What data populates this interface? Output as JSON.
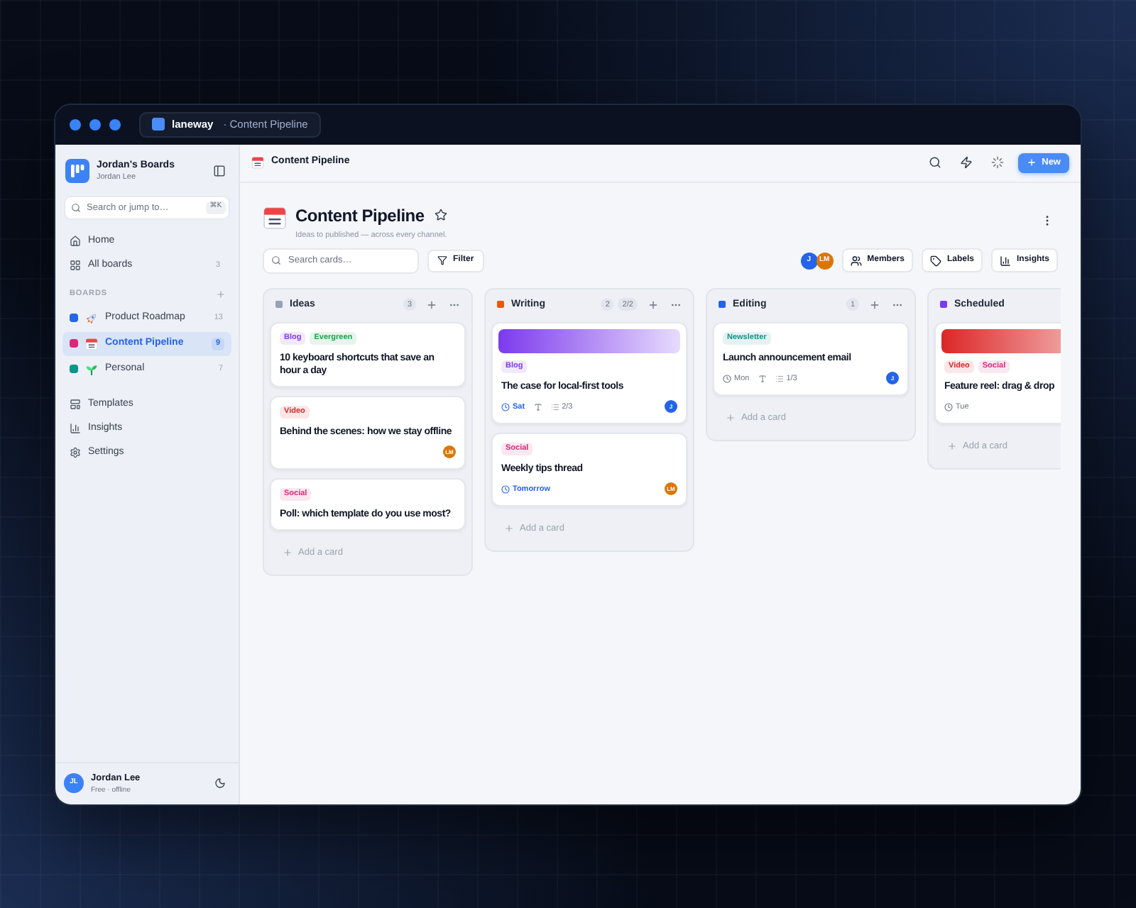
{
  "window": {
    "app_name": "laneway",
    "tab_title": "· Content Pipeline"
  },
  "sidebar": {
    "workspace": {
      "title": "Jordan's Boards",
      "subtitle": "Jordan Lee"
    },
    "search": {
      "placeholder": "Search or jump to…",
      "shortcut": "⌘K"
    },
    "nav": [
      {
        "label": "Home"
      },
      {
        "label": "All boards",
        "count": "3"
      }
    ],
    "boards_heading": "BOARDS",
    "boards": [
      {
        "label": "Product Roadmap",
        "count": "13",
        "color": "#2563eb",
        "selected": false
      },
      {
        "label": "Content Pipeline",
        "count": "9",
        "color": "#db2777",
        "selected": true
      },
      {
        "label": "Personal",
        "count": "7",
        "color": "#0d9488",
        "selected": false
      }
    ],
    "links": [
      {
        "label": "Templates"
      },
      {
        "label": "Insights"
      },
      {
        "label": "Settings"
      }
    ],
    "user": {
      "initials": "JL",
      "name": "Jordan Lee",
      "status": "Free · offline"
    }
  },
  "topbar": {
    "title": "Content Pipeline",
    "new_button": "New"
  },
  "header": {
    "title": "Content Pipeline",
    "starred": false,
    "subtitle": "Ideas to published — across every channel."
  },
  "toolbar": {
    "search": {
      "placeholder": "Search cards…"
    },
    "filter": "Filter",
    "members": [
      {
        "initials": "J",
        "color": "#2563eb"
      },
      {
        "initials": "LM",
        "color": "#d97706"
      }
    ],
    "buttons": [
      "Members",
      "Labels",
      "Insights"
    ]
  },
  "columns": [
    {
      "title": "Ideas",
      "color": "#94a3b8",
      "count": "3",
      "cards": [
        {
          "tags": [
            {
              "label": "Blog",
              "color": "#7c3aed"
            },
            {
              "label": "Evergreen",
              "color": "#16a34a"
            }
          ],
          "title": "10 keyboard shortcuts that save an hour a day"
        },
        {
          "tags": [
            {
              "label": "Video",
              "color": "#dc2626"
            }
          ],
          "title": "Behind the scenes: how we stay offline",
          "assignee": {
            "initials": "LM",
            "color": "#d97706"
          }
        },
        {
          "tags": [
            {
              "label": "Social",
              "color": "#db2777"
            }
          ],
          "title": "Poll: which template do you use most?"
        }
      ],
      "add_label": "Add a card"
    },
    {
      "title": "Writing",
      "color": "#ea580c",
      "count": "2",
      "secondary_count": "2/2",
      "cards": [
        {
          "cover": {
            "color": "#7c3aed"
          },
          "tags": [
            {
              "label": "Blog",
              "color": "#7c3aed"
            }
          ],
          "title": "The case for local-first tools",
          "date": {
            "label": "Sat",
            "highlighted": true
          },
          "text_marker": true,
          "list_count": "2/3",
          "assignee": {
            "initials": "J",
            "color": "#2563eb"
          }
        },
        {
          "tags": [
            {
              "label": "Social",
              "color": "#db2777"
            }
          ],
          "title": "Weekly tips thread",
          "date": {
            "label": "Tomorrow",
            "highlighted": true
          },
          "assignee": {
            "initials": "LM",
            "color": "#d97706"
          }
        }
      ],
      "add_label": "Add a card"
    },
    {
      "title": "Editing",
      "color": "#2563eb",
      "count": "1",
      "cards": [
        {
          "tags": [
            {
              "label": "Newsletter",
              "color": "#0d9488"
            }
          ],
          "title": "Launch announcement email",
          "date": {
            "label": "Mon",
            "highlighted": false
          },
          "text_marker": true,
          "list_count": "1/3",
          "assignee": {
            "initials": "J",
            "color": "#2563eb"
          }
        }
      ],
      "add_label": "Add a card"
    },
    {
      "title": "Scheduled",
      "color": "#7c3aed",
      "cards": [
        {
          "cover": {
            "color": "#dc2626"
          },
          "tags": [
            {
              "label": "Video",
              "color": "#dc2626"
            },
            {
              "label": "Social",
              "color": "#db2777"
            }
          ],
          "title": "Feature reel: drag & drop",
          "date": {
            "label": "Tue",
            "highlighted": false
          }
        }
      ],
      "add_label": "Add a card"
    }
  ]
}
